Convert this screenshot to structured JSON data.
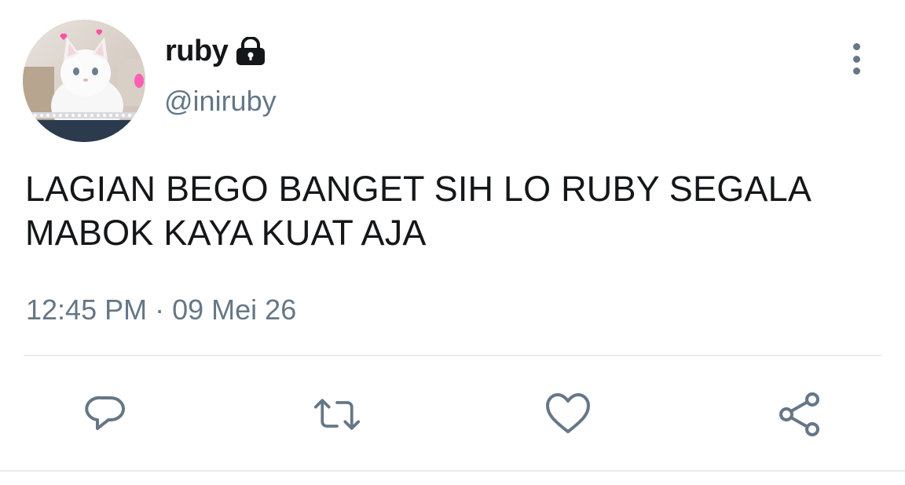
{
  "user": {
    "display_name": "ruby",
    "handle": "@iniruby",
    "avatar_icon": "white-cat-avatar",
    "protected_icon": "lock-icon"
  },
  "tweet": {
    "text": "LAGIAN BEGO BANGET SIH LO RUBY SEGALA MABOK KAYA KUAT AJA",
    "time": "12:45 PM",
    "separator": "·",
    "date": "09 Mei 26"
  },
  "actions": [
    {
      "icon": "reply-icon"
    },
    {
      "icon": "retweet-icon"
    },
    {
      "icon": "like-icon"
    },
    {
      "icon": "share-icon"
    }
  ],
  "colors": {
    "text_primary": "#14171a",
    "text_secondary": "#657786",
    "divider": "#e6ecf0"
  }
}
